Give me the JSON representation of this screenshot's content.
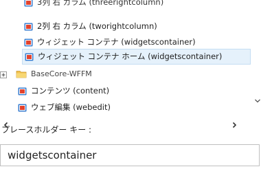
{
  "tree": {
    "items": [
      {
        "label": "3列 右 カラム (threerightcolumn)",
        "icon": "layout-item-icon"
      },
      {
        "label": "2列 右 カラム (tworightcolumn)",
        "icon": "layout-item-icon"
      },
      {
        "label": "ウィジェット コンテナ (widgetscontainer)",
        "icon": "layout-item-icon"
      },
      {
        "label": "ウィジェット コンテナ ホーム (widgetscontainer)",
        "icon": "layout-item-icon",
        "selected": true
      },
      {
        "label": "BaseCore-WFFM",
        "icon": "folder-icon"
      },
      {
        "label": "コンテンツ (content)",
        "icon": "layout-item-icon"
      },
      {
        "label": "ウェブ編集 (webedit)",
        "icon": "layout-item-icon"
      }
    ]
  },
  "placeholder_key": {
    "label": "プレースホルダー キー :",
    "value": "widgetscontainer"
  },
  "colors": {
    "selection_bg": "#e5f1fb",
    "selection_border": "#c4ddf3",
    "item_icon_blue": "#3b7fd0",
    "item_icon_red": "#e2432e",
    "folder_yellow": "#f2c14e"
  }
}
